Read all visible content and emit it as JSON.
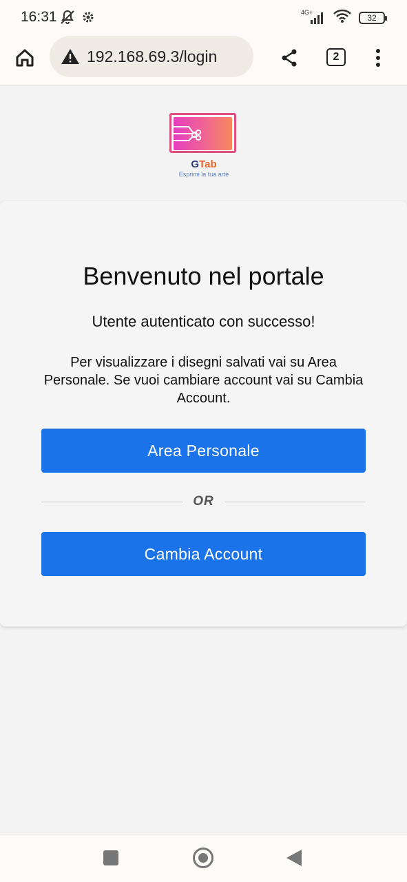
{
  "status_bar": {
    "time": "16:31",
    "network_label": "4G+",
    "battery": "32"
  },
  "browser": {
    "url": "192.168.69.3/login",
    "tab_count": "2"
  },
  "logo": {
    "name_part1": "G",
    "name_part2": "Tab",
    "tagline": "Esprimi la tua arte"
  },
  "card": {
    "title": "Benvenuto nel portale",
    "success_message": "Utente autenticato con successo!",
    "info_message": "Per visualizzare i disegni salvati vai su Area Personale. Se vuoi cambiare account vai su Cambia Account.",
    "area_button": "Area Personale",
    "divider_text": "OR",
    "cambia_button": "Cambia Account"
  },
  "colors": {
    "primary_button": "#1a73e8",
    "logo_gradient_start": "#e43fbf",
    "logo_gradient_end": "#f7875c"
  }
}
